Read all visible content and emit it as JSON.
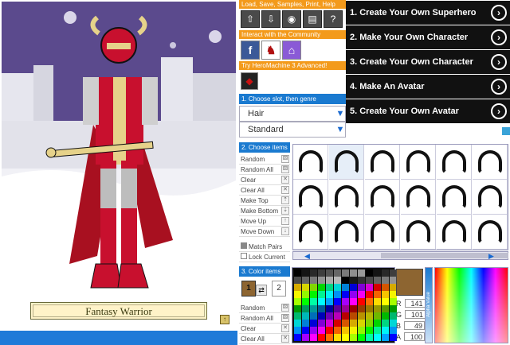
{
  "stage": {
    "character_name": "Fantasy Warrior"
  },
  "top_panel": {
    "header": "Load, Save, Samples, Print, Help",
    "tools": [
      "upload-icon",
      "download-icon",
      "eye-icon",
      "print-icon",
      "help-icon"
    ],
    "community_header": "Interact with the Community",
    "try_label": "Try HeroMachine 3 Advanced!"
  },
  "ads": [
    {
      "label": "1. Create Your Own Superhero"
    },
    {
      "label": "2. Make Your Own Character"
    },
    {
      "label": "3. Create Your Own Character"
    },
    {
      "label": "4. Make An Avatar"
    },
    {
      "label": "5. Create Your Own Avatar"
    }
  ],
  "slot": {
    "header": "1. Choose slot, then genre",
    "slot_value": "Hair",
    "genre_value": "Standard"
  },
  "items": {
    "header": "2. Choose items",
    "actions": [
      "Random",
      "Random All",
      "Clear",
      "Clear All",
      "Make Top",
      "Make Bottom",
      "Move Up",
      "Move Down"
    ],
    "match_pairs": "Match Pairs",
    "lock_current": "Lock Current"
  },
  "colors": {
    "header": "3. Color items",
    "slot_one": "1",
    "slot_two": "2",
    "actions": [
      "Random",
      "Random All",
      "Clear",
      "Clear All"
    ],
    "r_label": "R",
    "r": "141",
    "g_label": "G",
    "g": "101",
    "b_label": "B",
    "b": "49",
    "a_label": "A",
    "a": "100",
    "current_color": "#8d6531",
    "alpha_label": "Alpha Value"
  }
}
